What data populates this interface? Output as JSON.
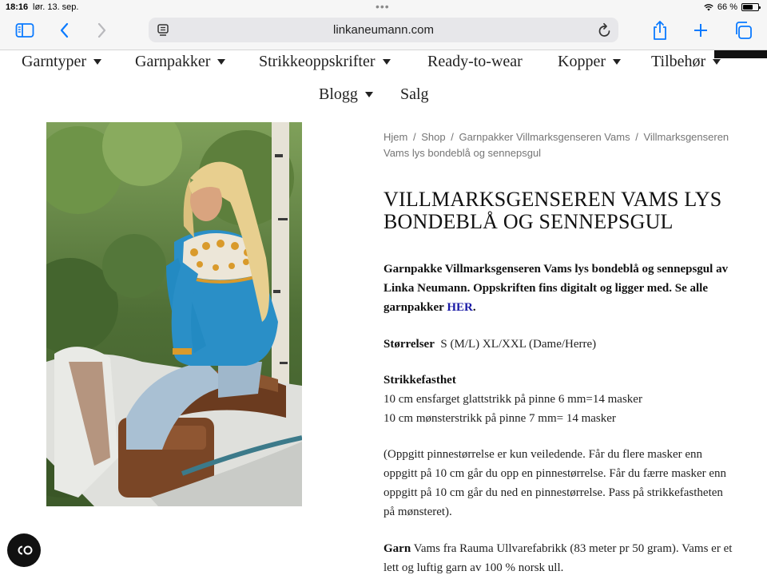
{
  "status": {
    "time": "18:16",
    "date": "lør. 13. sep.",
    "battery_text": "66 %",
    "battery_level": 0.66
  },
  "browser": {
    "url": "linkaneumann.com"
  },
  "nav": {
    "row1": [
      {
        "label": "Garntyper",
        "has_dropdown": true
      },
      {
        "label": "Garnpakker",
        "has_dropdown": true
      },
      {
        "label": "Strikkeoppskrifter",
        "has_dropdown": true
      },
      {
        "label": "Ready-to-wear",
        "has_dropdown": false
      },
      {
        "label": "Kopper",
        "has_dropdown": true
      },
      {
        "label": "Tilbehør",
        "has_dropdown": true
      }
    ],
    "row2": [
      {
        "label": "Blogg",
        "has_dropdown": true
      },
      {
        "label": "Salg",
        "has_dropdown": false
      }
    ]
  },
  "breadcrumb": {
    "items": [
      "Hjem",
      "Shop",
      "Garnpakker Villmarksgenseren Vams",
      "Villmarksgenseren Vams lys bondeblå og sennepsgul"
    ],
    "separator": "/"
  },
  "product": {
    "title": "VILLMARKSGENSEREN VAMS LYS BONDEBLÅ OG SENNEPSGUL",
    "description_text": "Garnpakke Villmarksgenseren Vams lys bondeblå og sennepsgul av Linka Neumann. Oppskriften fins digitalt og ligger med. Se alle garnpakker",
    "description_link": "HER",
    "description_end": ".",
    "sizes_label": "Størrelser",
    "sizes_value": "S (M/L) XL/XXL (Dame/Herre)",
    "gauge_label": "Strikkefasthet",
    "gauge_line1": "10 cm ensfarget glattstrikk på pinne 6 mm=14 masker",
    "gauge_line2": "10 cm mønsterstrikk på pinne 7 mm= 14 masker",
    "note": "(Oppgitt pinnestørrelse er kun veiledende. Får du flere masker enn oppgitt på 10 cm går du opp en pinnestørrelse. Får du færre masker enn oppgitt på 10 cm går du ned en pinnestørrelse. Pass på strikkefastheten på mønsteret).",
    "yarn_label": "Garn",
    "yarn_value": "Vams fra Rauma Ullvarefabrikk (83 meter pr 50 gram). Vams er et lett og luftig garn av 100 % norsk ull."
  },
  "colors": {
    "link": "#1a1aa6",
    "accent_blue": "#2a8fc7",
    "mustard": "#d99a2b",
    "safari_blue": "#0a7aff"
  },
  "icons": [
    "sidebar-icon",
    "back-icon",
    "forward-icon",
    "tab-icon",
    "reload-icon",
    "share-icon",
    "new-tab-icon",
    "tabs-overview-icon",
    "wifi-icon",
    "battery-icon",
    "cookie-settings-icon"
  ]
}
